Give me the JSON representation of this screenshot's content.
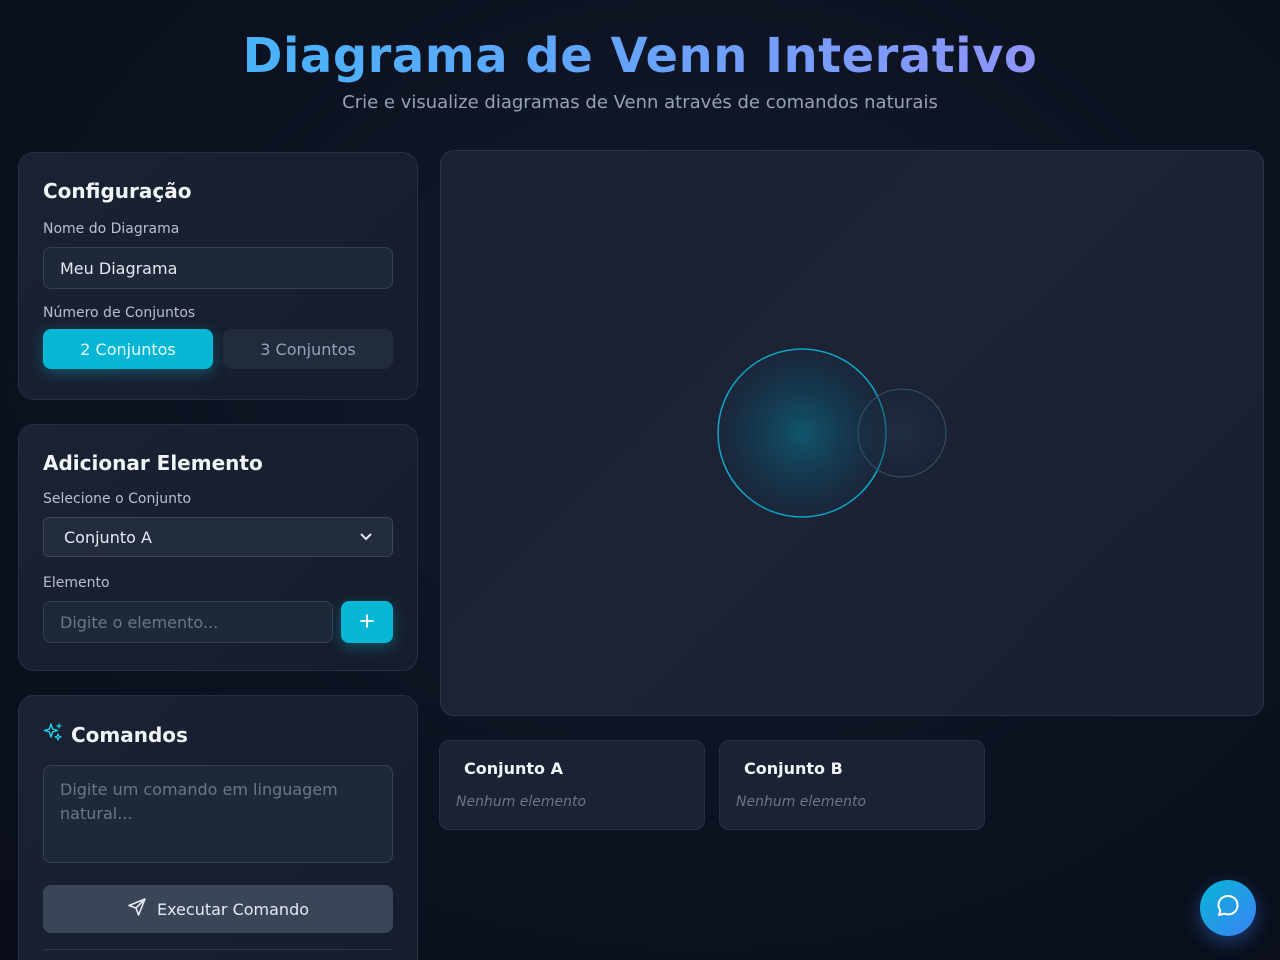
{
  "header": {
    "title": "Diagrama de Venn Interativo",
    "subtitle": "Crie e visualize diagramas de Venn através de comandos naturais"
  },
  "config": {
    "title": "Configuração",
    "name_label": "Nome do Diagrama",
    "name_value": "Meu Diagrama",
    "count_label": "Número de Conjuntos",
    "options": [
      "2 Conjuntos",
      "3 Conjuntos"
    ],
    "selected_option": "2 Conjuntos"
  },
  "add_element": {
    "title": "Adicionar Elemento",
    "select_label": "Selecione o Conjunto",
    "select_value": "Conjunto A",
    "element_label": "Elemento",
    "element_placeholder": "Digite o elemento...",
    "add_icon": "plus-icon"
  },
  "commands": {
    "title": "Comandos",
    "icon": "sparkles-icon",
    "placeholder": "Digite um comando em linguagem natural...",
    "execute_label": "Executar Comando",
    "execute_icon": "send-icon"
  },
  "sets": [
    {
      "name": "Conjunto A",
      "empty_text": "Nenhum elemento"
    },
    {
      "name": "Conjunto B",
      "empty_text": "Nenhum elemento"
    }
  ],
  "colors": {
    "accent": "#06b6d4",
    "title_gradient_start": "#38bdf8",
    "title_gradient_end": "#a78bfa"
  },
  "chat": {
    "icon": "chat-bubble-icon"
  }
}
